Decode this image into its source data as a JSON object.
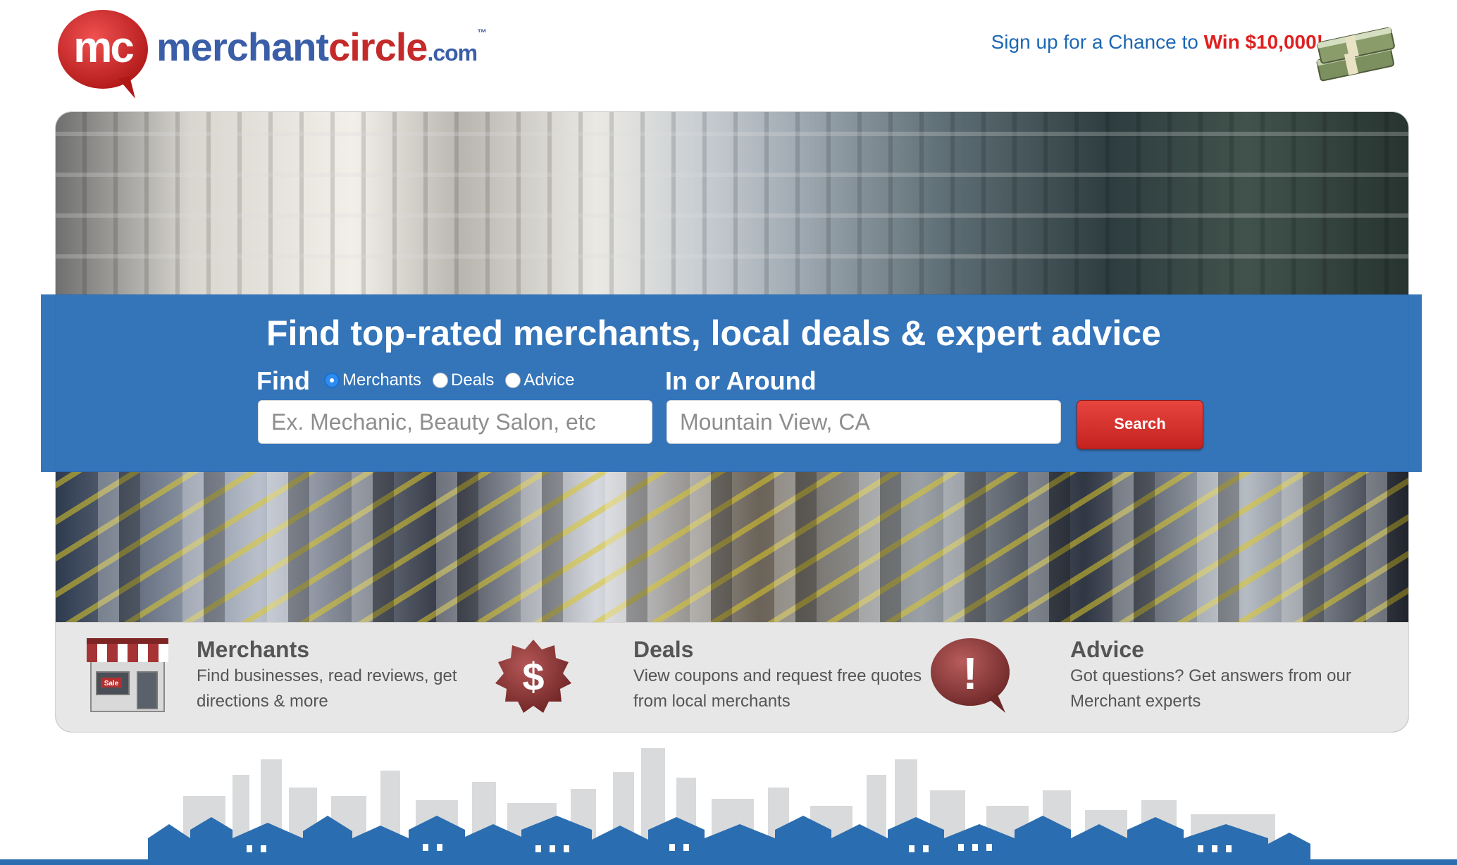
{
  "brand": {
    "logo_badge": "mc",
    "name_part1": "merchant",
    "name_part2": "circle",
    "tld": ".com",
    "trademark": "™"
  },
  "promo": {
    "text": "Sign up for a Chance to ",
    "highlight": "Win $10,000!"
  },
  "hero": {
    "headline": "Find top-rated merchants, local deals & expert advice",
    "find_label": "Find",
    "search_types": [
      {
        "label": "Merchants",
        "selected": true
      },
      {
        "label": "Deals",
        "selected": false
      },
      {
        "label": "Advice",
        "selected": false
      }
    ],
    "near_label": "In or Around",
    "what_placeholder": "Ex. Mechanic, Beauty Salon, etc",
    "where_placeholder": "Mountain View, CA",
    "search_button": "Search"
  },
  "features": [
    {
      "title": "Merchants",
      "description": "Find businesses, read reviews, get directions & more",
      "icon": "storefront-icon",
      "icon_text": "Sale"
    },
    {
      "title": "Deals",
      "description": "View coupons and request free quotes from local merchants",
      "icon": "dollar-badge-icon",
      "icon_text": "$"
    },
    {
      "title": "Advice",
      "description": "Got questions? Get answers from our Merchant experts",
      "icon": "exclamation-bubble-icon",
      "icon_text": "!"
    }
  ],
  "colors": {
    "brand_blue": "#266cb6",
    "brand_red": "#c42a2a",
    "promo_blue": "#1d67b4",
    "search_red": "#d6322e"
  }
}
